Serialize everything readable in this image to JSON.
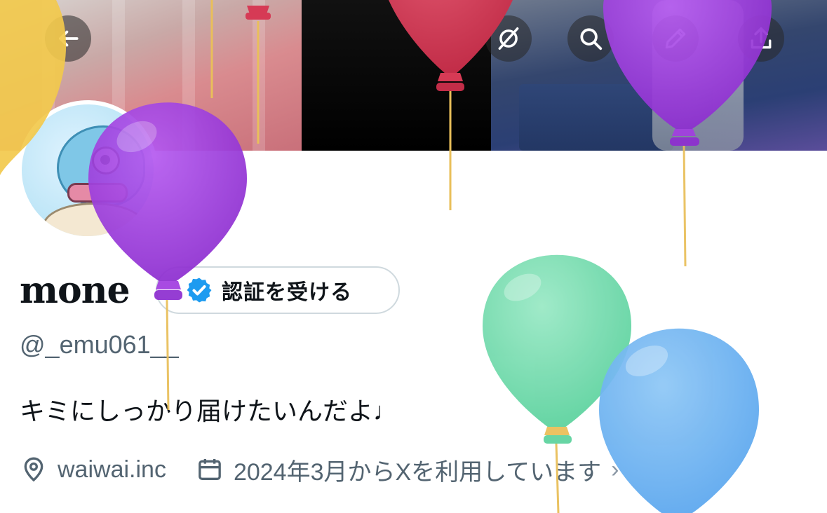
{
  "header": {
    "back_icon": "arrow-left-icon",
    "buttons": [
      {
        "icon": "eye-slash-icon"
      },
      {
        "icon": "search-icon"
      },
      {
        "icon": "pencil-icon"
      },
      {
        "icon": "share-upload-icon"
      }
    ]
  },
  "profile": {
    "display_name": "mone",
    "verify_button_label": "認証を受ける",
    "verify_badge_icon": "verified-badge-icon",
    "handle": "@_emu061__",
    "bio": "キミにしっかり届けたいんだよ♩",
    "location_icon": "location-pin-icon",
    "location": "waiwai.inc",
    "joined_icon": "calendar-icon",
    "joined": "2024年3月からXを利用しています",
    "chevron": "›"
  },
  "colors": {
    "accent_blue": "#1d9bf0",
    "text_primary": "#0f1419",
    "text_secondary": "#536471",
    "balloon_purple": "#a23ee0",
    "balloon_red": "#d63a55",
    "balloon_green": "#7ddfb2",
    "balloon_blue": "#6fb7f2",
    "balloon_yellow": "#f2c94c"
  }
}
